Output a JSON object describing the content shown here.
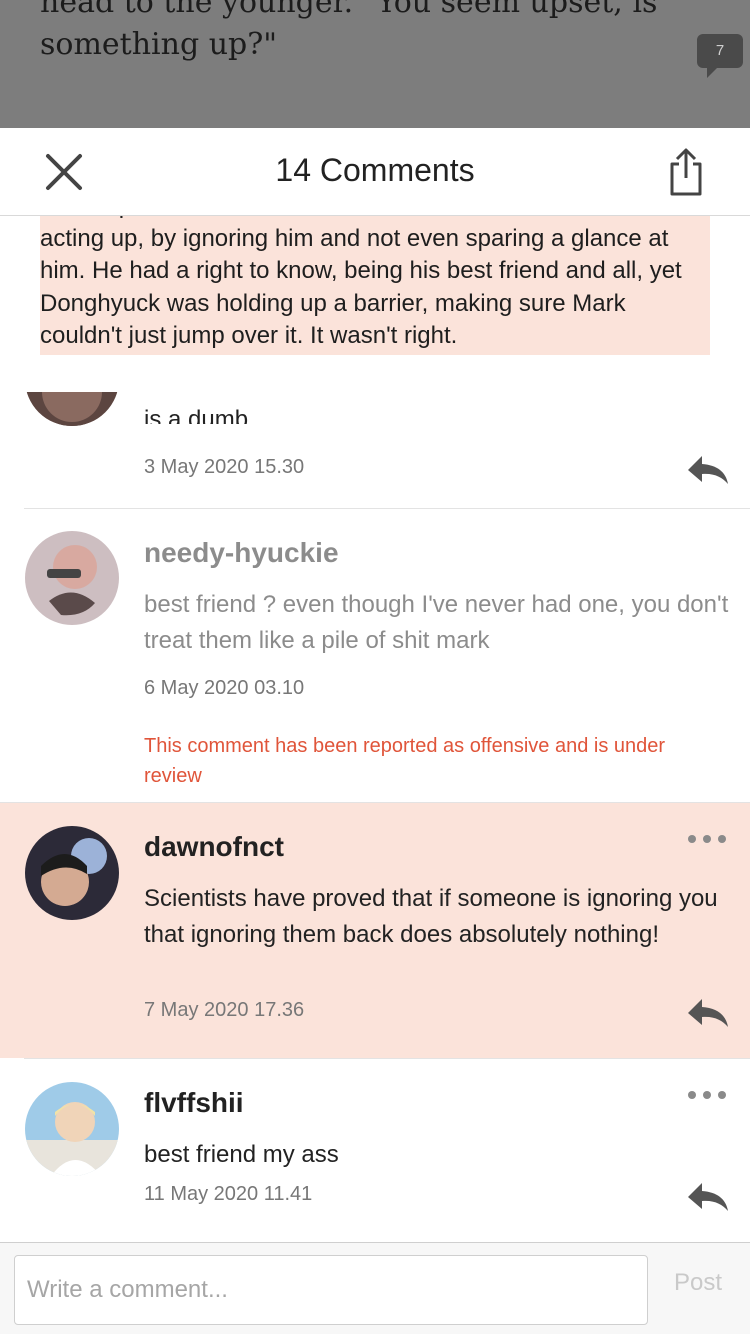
{
  "story": {
    "text_line1": "head to the younger. \"You seem upset, is",
    "text_line2": "something up?\"",
    "inline_comment_count": "7"
  },
  "header": {
    "title": "14 Comments",
    "close_icon": "close-icon",
    "share_icon": "share-icon"
  },
  "quote": {
    "text": "of the spectrum rather than the sad since his best friend was acting up, by ignoring him and not even sparing a glance at him. He had a right to know, being his best friend and all, yet Donghyuck was holding up a barrier, making sure Mark couldn't just jump over it. It wasn't right."
  },
  "comments": [
    {
      "body": "is a dumb",
      "date": "3 May 2020 15.30"
    },
    {
      "username": "needy-hyuckie",
      "body": "best friend ? even though I've never had one, you don't treat them like a pile of shit mark",
      "date": "6 May 2020 03.10",
      "notice": "This comment has been reported as offensive and is under review"
    },
    {
      "username": "dawnofnct",
      "body": "Scientists have proved that if someone is ignoring you that ignoring them back does absolutely nothing!",
      "date": "7 May 2020 17.36"
    },
    {
      "username": "flvffshii",
      "body": "best friend my ass",
      "date": "11 May 2020 11.41"
    }
  ],
  "composer": {
    "placeholder": "Write a comment...",
    "value": "",
    "post_label": "Post"
  },
  "colors": {
    "highlight": "#fbe3da",
    "reported": "#e0553a",
    "overlay": "#7d7d7d"
  }
}
